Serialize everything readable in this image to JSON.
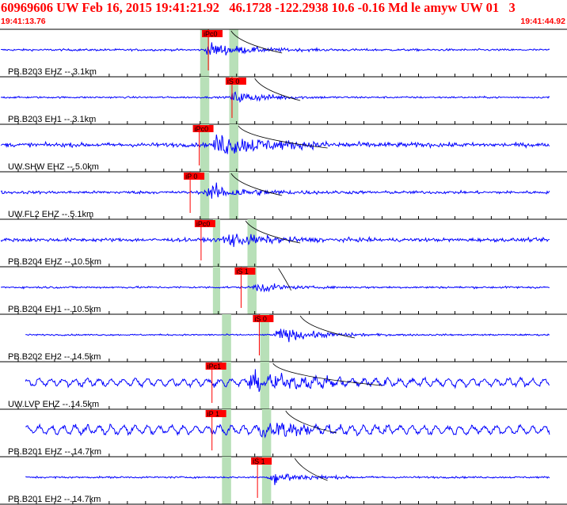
{
  "header": {
    "title": "60969606 UW Feb 16, 2015 19:41:21.92   46.1728 -122.2938 10.6 -0.16 Md le amyw UW 01   3",
    "start_time": "19:41:13.76",
    "end_time": "19:41:44.92"
  },
  "colors": {
    "trace": "#0000ff",
    "header": "#ff0000",
    "pick_box": "#ff0000",
    "pick_line": "#ff0000",
    "window_band": "#b8e0b8",
    "separator": "#000000"
  },
  "chart_data": {
    "type": "line",
    "title": "60969606 UW Feb 16, 2015 19:41:21.92   46.1728 -122.2938 10.6 -0.16 Md le amyw UW 01   3",
    "x_range": [
      "19:41:13.76",
      "19:41:44.92"
    ],
    "x_range_seconds": [
      0,
      31.16
    ],
    "grid": false,
    "series": [
      {
        "name": "PB.B203 EHZ --.3.1km",
        "pick": "iPc0",
        "pick_time": 11.1,
        "band_start": 11.0,
        "band_end": 11.5,
        "band2_start": 12.6,
        "band2_end": 13.1,
        "onset": 11.2,
        "coda_end": 15.5,
        "amp": 0.55,
        "noise": 0.07,
        "end": 31.16
      },
      {
        "name": "PB.B203 EH1 --.3.1km",
        "pick": "iS 0",
        "pick_time": 12.4,
        "band_start": 11.0,
        "band_end": 11.5,
        "band2_start": 12.6,
        "band2_end": 13.1,
        "onset": 12.5,
        "coda_end": 16.5,
        "amp": 0.5,
        "noise": 0.06,
        "end": 31.16
      },
      {
        "name": "UW.SHW EHZ --.5.0km",
        "pick": "iPc0",
        "pick_time": 10.6,
        "band_start": 11.0,
        "band_end": 11.5,
        "band2_start": 12.6,
        "band2_end": 13.1,
        "onset": 11.6,
        "coda_end": 18.0,
        "amp": 0.85,
        "noise": 0.14,
        "end": 31.16
      },
      {
        "name": "UW.FL2 EHZ --.5.1km",
        "pick": "iP 0",
        "pick_time": 10.1,
        "band_start": 11.0,
        "band_end": 11.5,
        "band2_start": 12.6,
        "band2_end": 13.1,
        "onset": 11.2,
        "coda_end": 15.5,
        "amp": 0.6,
        "noise": 0.1,
        "end": 31.16
      },
      {
        "name": "PB.B204 EHZ --.10.5km",
        "pick": "iPc0",
        "pick_time": 10.7,
        "band_start": 11.7,
        "band_end": 12.1,
        "band2_start": 13.6,
        "band2_end": 14.1,
        "onset": 12.0,
        "coda_end": 16.5,
        "amp": 0.6,
        "noise": 0.12,
        "end": 31.16
      },
      {
        "name": "PB.B204 EH1 --.10.5km",
        "pick": "iS 1",
        "pick_time": 12.9,
        "band_start": 11.7,
        "band_end": 12.1,
        "band2_start": 13.6,
        "band2_end": 14.1,
        "onset": 13.8,
        "coda_end": 16.0,
        "amp": 0.55,
        "noise": 0.07,
        "end": 31.16
      },
      {
        "name": "PB.B202 EH2 --.14.5km",
        "pick": "iS 0",
        "pick_time": 13.9,
        "band_start": 12.2,
        "band_end": 12.7,
        "band2_start": 14.3,
        "band2_end": 14.8,
        "onset": 15.0,
        "coda_end": 19.5,
        "amp": 0.55,
        "noise": 0.05,
        "end": 31.16
      },
      {
        "name": "UW.LVP EHZ --.14.5km",
        "pick": "iPc1",
        "pick_time": 11.3,
        "band_start": 12.2,
        "band_end": 12.7,
        "band2_start": 14.3,
        "band2_end": 14.8,
        "onset": 13.5,
        "coda_end": 21.0,
        "amp": 0.55,
        "noise": 0.14,
        "end": 31.16
      },
      {
        "name": "PB.B201 EHZ --.14.7km",
        "pick": "iP 1",
        "pick_time": 11.3,
        "band_start": 12.2,
        "band_end": 12.7,
        "band2_start": 14.4,
        "band2_end": 14.9,
        "onset": 14.2,
        "coda_end": 18.5,
        "amp": 0.6,
        "noise": 0.16,
        "end": 31.16
      },
      {
        "name": "PB.B201 EH2 --.14.7km",
        "pick": "iS 1",
        "pick_time": 13.8,
        "band_start": 12.2,
        "band_end": 12.7,
        "band2_start": 14.4,
        "band2_end": 14.9,
        "onset": 14.7,
        "coda_end": 18.0,
        "amp": 0.6,
        "noise": 0.06,
        "end": 31.16
      }
    ]
  }
}
